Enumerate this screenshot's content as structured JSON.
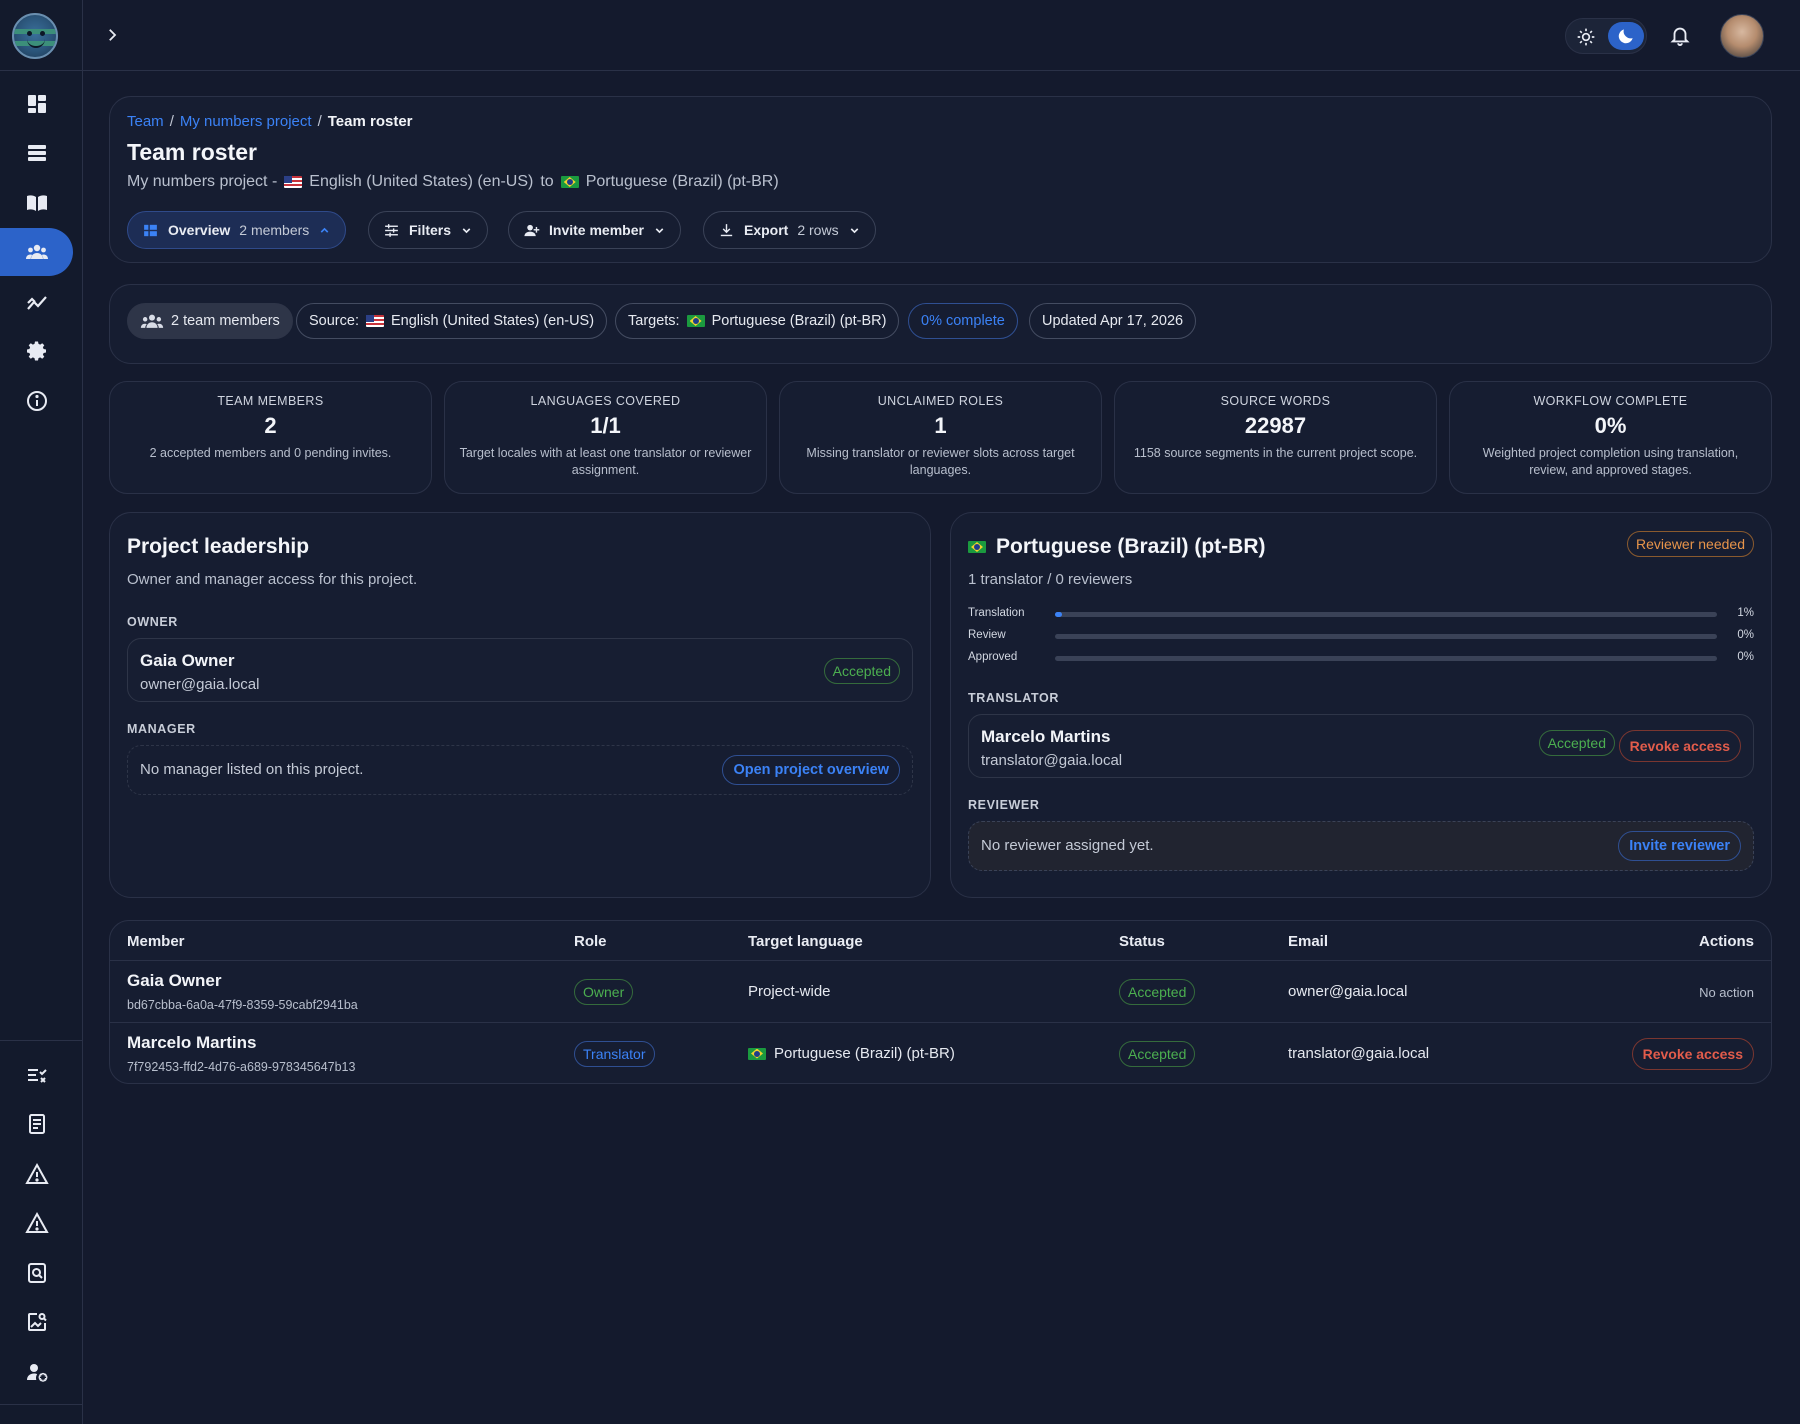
{
  "topbar": {
    "theme": "dark"
  },
  "breadcrumb": {
    "team": "Team",
    "project": "My numbers project",
    "current": "Team roster"
  },
  "page": {
    "title": "Team roster",
    "subtitle_project": "My numbers project -",
    "source_language": "English (United States) (en-US)",
    "to": "to",
    "target_language": "Portuguese (Brazil) (pt-BR)"
  },
  "toolbar": {
    "overview_label": "Overview",
    "overview_count": "2 members",
    "filters_label": "Filters",
    "invite_label": "Invite member",
    "export_label": "Export",
    "export_count": "2 rows"
  },
  "chips": {
    "members": "2 team members",
    "source_prefix": "Source:",
    "source": "English (United States) (en-US)",
    "targets_prefix": "Targets:",
    "targets": "Portuguese (Brazil) (pt-BR)",
    "complete": "0% complete",
    "updated": "Updated Apr 17, 2026"
  },
  "stats": [
    {
      "label": "TEAM MEMBERS",
      "value": "2",
      "desc": "2 accepted members and 0 pending invites."
    },
    {
      "label": "LANGUAGES COVERED",
      "value": "1/1",
      "desc": "Target locales with at least one translator or reviewer assignment."
    },
    {
      "label": "UNCLAIMED ROLES",
      "value": "1",
      "desc": "Missing translator or reviewer slots across target languages."
    },
    {
      "label": "SOURCE WORDS",
      "value": "22987",
      "desc": "1158 source segments in the current project scope."
    },
    {
      "label": "WORKFLOW COMPLETE",
      "value": "0%",
      "desc": "Weighted project completion using translation, review, and approved stages."
    }
  ],
  "leadership": {
    "title": "Project leadership",
    "subtitle": "Owner and manager access for this project.",
    "owner_label": "OWNER",
    "owner_name": "Gaia Owner",
    "owner_email": "owner@gaia.local",
    "owner_status": "Accepted",
    "manager_label": "MANAGER",
    "manager_empty": "No manager listed on this project.",
    "manager_action": "Open project overview"
  },
  "language_panel": {
    "title": "Portuguese (Brazil) (pt-BR)",
    "badge": "Reviewer needed",
    "summary": "1 translator / 0 reviewers",
    "progress": [
      {
        "label": "Translation",
        "value": 1,
        "display": "1%"
      },
      {
        "label": "Review",
        "value": 0,
        "display": "0%"
      },
      {
        "label": "Approved",
        "value": 0,
        "display": "0%"
      }
    ],
    "translator_label": "TRANSLATOR",
    "translator_name": "Marcelo Martins",
    "translator_email": "translator@gaia.local",
    "translator_status": "Accepted",
    "translator_action": "Revoke access",
    "reviewer_label": "REVIEWER",
    "reviewer_empty": "No reviewer assigned yet.",
    "reviewer_action": "Invite reviewer"
  },
  "table": {
    "headers": {
      "member": "Member",
      "role": "Role",
      "target": "Target language",
      "status": "Status",
      "email": "Email",
      "actions": "Actions"
    },
    "rows": [
      {
        "name": "Gaia Owner",
        "id": "bd67cbba-6a0a-47f9-8359-59cabf2941ba",
        "role": "Owner",
        "target": "Project-wide",
        "status": "Accepted",
        "email": "owner@gaia.local",
        "action": "No action"
      },
      {
        "name": "Marcelo Martins",
        "id": "7f792453-ffd2-4d76-a689-978345647b13",
        "role": "Translator",
        "target": "Portuguese (Brazil) (pt-BR)",
        "status": "Accepted",
        "email": "translator@gaia.local",
        "action": "Revoke access"
      }
    ]
  },
  "colors": {
    "accent": "#2c63c9",
    "link": "#3b82f6",
    "success": "#4caf50",
    "warning": "#e7944a",
    "danger": "#e25c4b",
    "background": "#141a2d"
  }
}
